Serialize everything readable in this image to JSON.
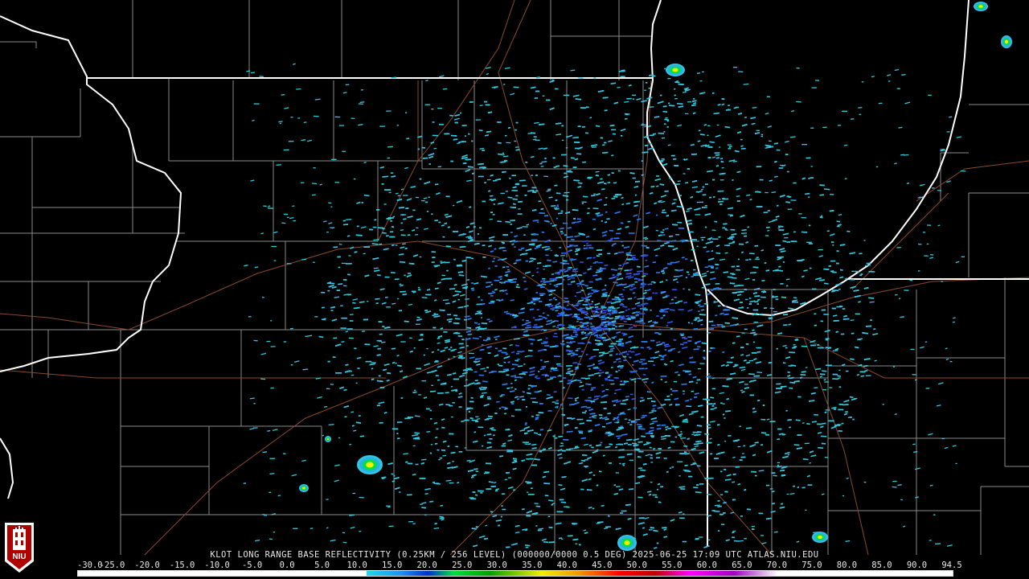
{
  "product": {
    "caption": "KLOT LONG RANGE BASE REFLECTIVITY (0.25KM / 256 LEVEL) (000000/0000 0.5 DEG) 2025-06-25 17:09 UTC  ATLAS.NIU.EDU"
  },
  "scale": {
    "labels": [
      "-30.0",
      "-25.0",
      "-20.0",
      "-15.0",
      "-10.0",
      "-5.0",
      "0.0",
      "5.0",
      "10.0",
      "15.0",
      "20.0",
      "25.0",
      "30.0",
      "35.0",
      "40.0",
      "45.0",
      "50.0",
      "55.0",
      "60.0",
      "65.0",
      "70.0",
      "75.0",
      "80.0",
      "85.0",
      "90.0",
      "94.5"
    ],
    "unit_note": ""
  },
  "logo": {
    "text": "NIU"
  },
  "colors": {
    "background": "#000000",
    "state_border": "#ffffff",
    "county_border": "#8a8a8a",
    "road": "#8b4a2b",
    "echo_light": "#30c8e0",
    "echo_mid": "#2a7ae8",
    "echo_strong": "#00e040",
    "echo_core": "#f0f000"
  },
  "icons": [
    "radar-site-marker",
    "niu-logo-icon"
  ]
}
